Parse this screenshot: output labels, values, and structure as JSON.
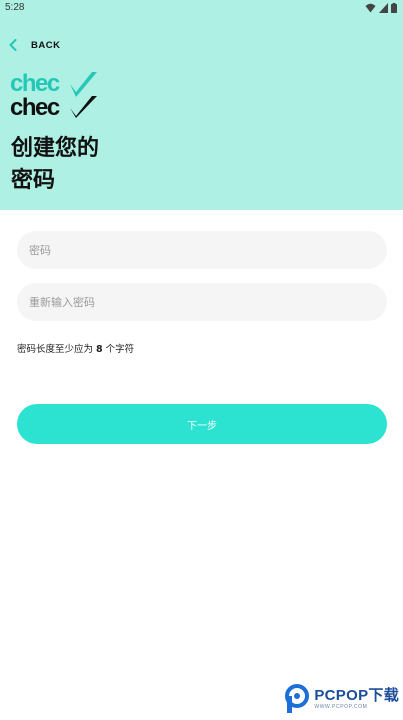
{
  "status_bar": {
    "time": "5:28",
    "icons": [
      "wifi-icon",
      "signal-icon",
      "battery-icon"
    ]
  },
  "nav": {
    "back_label": "BACK",
    "back_icon": "chevron-left-icon"
  },
  "brand": {
    "logo_text": "checkcheck"
  },
  "header": {
    "title_line1": "创建您的",
    "title_line2": "密码",
    "background_color": "#aef0e4"
  },
  "form": {
    "password_placeholder": "密码",
    "password_value": "",
    "confirm_placeholder": "重新输入密码",
    "confirm_value": "",
    "hint_prefix": "密码长度至少应为 ",
    "hint_number": "8",
    "hint_suffix": " 个字符"
  },
  "actions": {
    "next_label": "下一步",
    "accent_color": "#2ce2d0"
  },
  "watermark": {
    "text": "PCPOP下载",
    "sub": "WWW.PCPOP.COM"
  }
}
